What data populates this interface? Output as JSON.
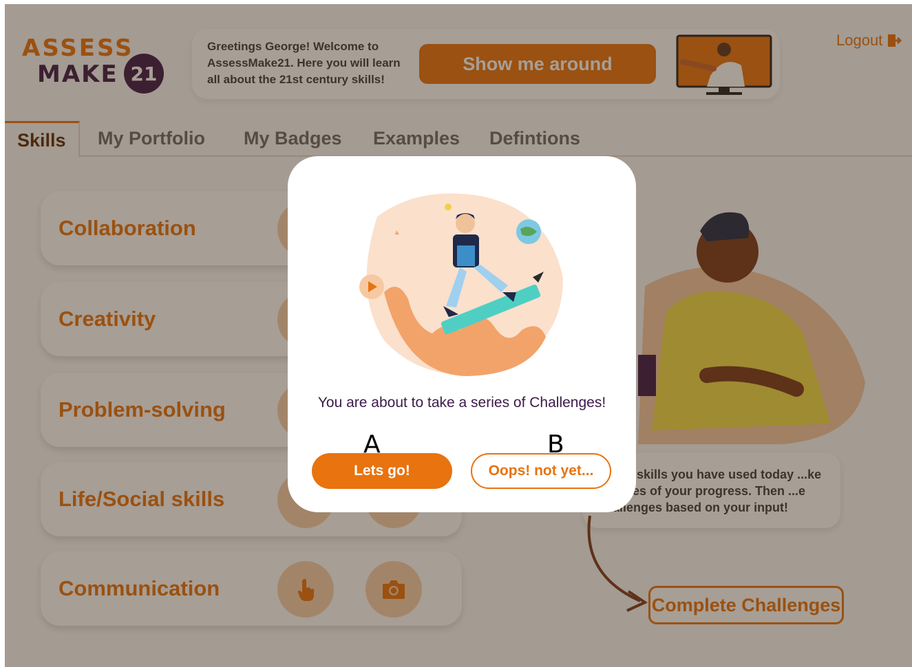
{
  "logo": {
    "line1": "ASSESS",
    "line2": "MAKE",
    "badge": "21"
  },
  "greeting": {
    "text": "Greetings George! Welcome to AssessMake21. Here you will learn all about the 21st century skills!",
    "button": "Show me around"
  },
  "logout": {
    "label": "Logout"
  },
  "tabs": [
    {
      "label": "Skills"
    },
    {
      "label": "My Portfolio"
    },
    {
      "label": "My Badges"
    },
    {
      "label": "Examples"
    },
    {
      "label": "Defintions"
    }
  ],
  "skills": [
    {
      "label": "Collaboration"
    },
    {
      "label": "Creativity"
    },
    {
      "label": "Problem-solving"
    },
    {
      "label": "Life/Social skills"
    },
    {
      "label": "Communication"
    }
  ],
  "hint": {
    "text": "which skills you have used today ...ke pictures of your progress. Then ...e challenges based on your input!"
  },
  "complete": {
    "label": "Complete Challenges"
  },
  "modal": {
    "message": "You are about to take a series of Challenges!",
    "go_label": "Lets go!",
    "no_label": "Oops! not yet..."
  },
  "markers": {
    "a": "A",
    "b": "B"
  },
  "colors": {
    "accent": "#e8730f",
    "brand_dark": "#3d1a4a",
    "overlay": "rgba(60,40,20,0.45)"
  }
}
